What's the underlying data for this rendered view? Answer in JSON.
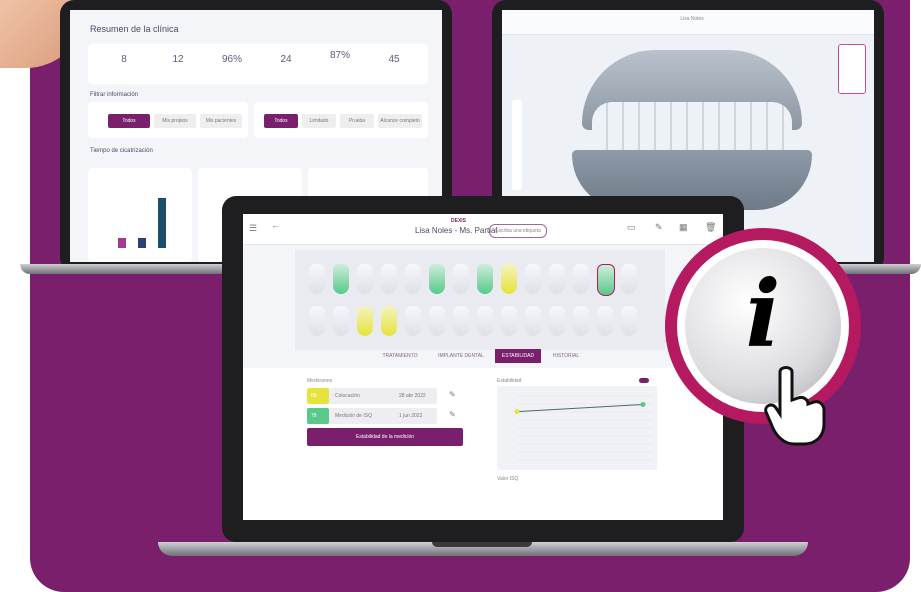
{
  "left_screen": {
    "title": "Resumen de la clínica",
    "stats": [
      "8",
      "12",
      "96%",
      "24",
      "87%",
      "45"
    ],
    "filter_title": "Filtrar información",
    "buttons": [
      "Todos",
      "Mis propios",
      "Mis pacientes",
      "Todos",
      "Limitado",
      "Prueba",
      "Alcance completo"
    ],
    "section2_title": "Tiempo de cicatrización"
  },
  "right_screen": {
    "title": "Lisa Noles"
  },
  "front_screen": {
    "brand": "DEXIS",
    "title": "Lisa Noles - Ms. Partial",
    "search_placeholder": "Escriba una etiqueta",
    "tabs": [
      "TRATAMIENTO",
      "IMPLANTE DENTAL",
      "ESTABILIDAD",
      "HISTORIAL"
    ],
    "active_tab": "ESTABILIDAD",
    "measurements_label": "Mediciones",
    "rows": [
      {
        "value": "68",
        "label": "Colocación",
        "date": "28 abr 2022"
      },
      {
        "value": "78",
        "label": "Medición de ISQ",
        "date": "1 jun 2022"
      }
    ],
    "action_button": "Estabilidad de la medición",
    "chart_title": "Estabilidad",
    "chart_note": "Valor ISQ"
  },
  "colors": {
    "brand": "#7a1f6c",
    "yellow": "#e6e33a",
    "green": "#58c98a",
    "info_ring": "#b5195f"
  },
  "chart_data": {
    "type": "line",
    "x": [
      "28 abr 2022",
      "1 jun 2022"
    ],
    "series": [
      {
        "values": [
          68,
          78
        ]
      }
    ],
    "ylim": [
      0,
      90
    ]
  }
}
